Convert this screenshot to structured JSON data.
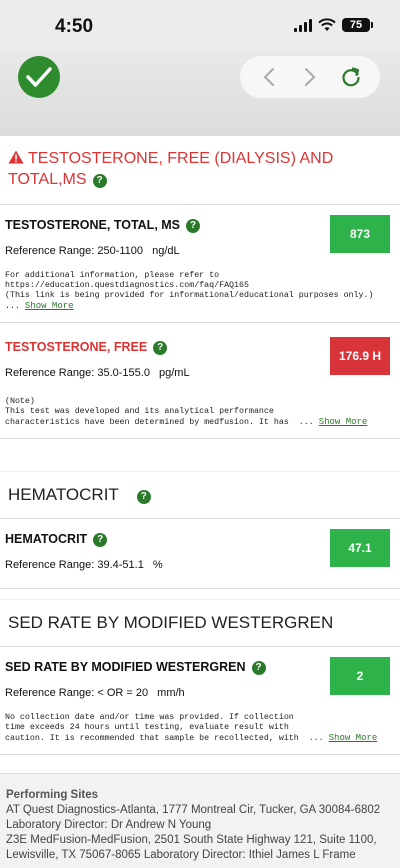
{
  "status_bar": {
    "time": "4:50",
    "battery": "75"
  },
  "sections": {
    "testosterone": {
      "title": "TESTOSTERONE, FREE (DIALYSIS) AND TOTAL,MS",
      "tests": [
        {
          "name": "TESTOSTERONE, TOTAL, MS",
          "reference_label": "Reference Range:",
          "reference_range": "250-1100",
          "unit": "ng/dL",
          "value": "873",
          "note": "For additional information, please refer to\nhttps://education.questdiagnostics.com/faq/FAQ165\n(This link is being provided for informational/educational purposes only.)\n... ",
          "show_more": "Show More"
        },
        {
          "name": "TESTOSTERONE, FREE",
          "reference_label": "Reference Range:",
          "reference_range": "35.0-155.0",
          "unit": "pg/mL",
          "value": "176.9 H",
          "note": "(Note)\nThis test was developed and its analytical performance\ncharacteristics have been determined by medfusion. It has  ... ",
          "show_more": "Show More"
        }
      ]
    },
    "hematocrit": {
      "title": "HEMATOCRIT",
      "test": {
        "name": "HEMATOCRIT",
        "reference_label": "Reference Range:",
        "reference_range": "39.4-51.1",
        "unit": "%",
        "value": "47.1"
      }
    },
    "sed_rate": {
      "title": "SED RATE BY MODIFIED WESTERGREN",
      "test": {
        "name": "SED RATE BY MODIFIED WESTERGREN",
        "reference_label": "Reference Range:",
        "reference_range": "< OR = 20",
        "unit": "mm/h",
        "value": "2",
        "note": "No collection date and/or time was provided. If collection\ntime exceeds 24 hours until testing, evaluate result with\ncaution. It is recommended that sample be recollected, with  ... ",
        "show_more": "Show More"
      }
    }
  },
  "footer": {
    "title": "Performing Sites",
    "lines": [
      "AT Quest Diagnostics-Atlanta, 1777 Montreal Cir, Tucker, GA 30084-6802 Laboratory Director: Dr Andrew N Young",
      "Z3E MedFusion-MedFusion, 2501 South State Highway 121, Suite 1100, Lewisville, TX 75067-8065 Laboratory Director: Ithiel James L Frame"
    ]
  },
  "colors": {
    "accent_green": "#2b7a2b",
    "normal_value": "#2db34a",
    "high_value": "#d9343a",
    "alert_text": "#d33333"
  },
  "icons": {
    "toolbar": [
      "checkmark-icon",
      "back-arrow-icon",
      "forward-arrow-icon",
      "refresh-icon"
    ],
    "help": "question-icon",
    "alert": "warning-icon"
  }
}
